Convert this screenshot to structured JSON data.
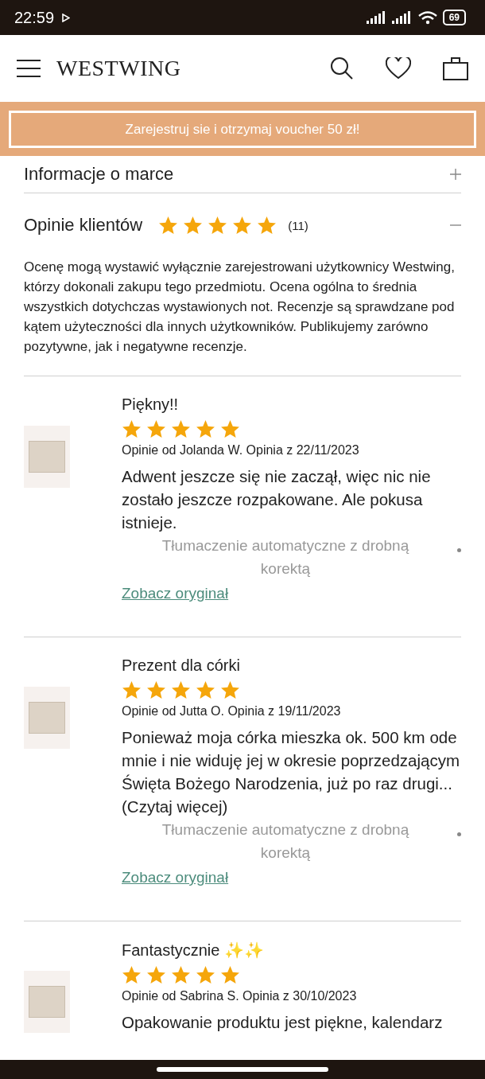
{
  "status_bar": {
    "time": "22:59",
    "battery": "69"
  },
  "header": {
    "logo": "WESTWING"
  },
  "banner": {
    "text": "Zarejestruj sie i otrzymaj voucher 50 zł!"
  },
  "sections": [
    {
      "title": "Informacje o marce",
      "expanded": false
    }
  ],
  "reviews_section": {
    "title": "Opinie klientów",
    "stars": 5,
    "count": "(11)",
    "expanded": true,
    "description": "Ocenę mogą wystawić wyłącznie zarejestrowani użytkownicy Westwing, którzy dokonali zakupu tego przedmiotu. Ocena ogólna to średnia wszystkich dotychczas wystawionych not. Recenzje są sprawdzane pod kątem użyteczności dla innych użytkowników. Publikujemy zarówno pozytywne, jak i negatywne recenzje."
  },
  "reviews": [
    {
      "title": "Piękny!!",
      "stars": 5,
      "meta": "Opinie od Jolanda W. Opinia z 22/11/2023",
      "body": "Adwent jeszcze się nie zaczął, więc nic nie zostało jeszcze rozpakowane. Ale pokusa istnieje.",
      "translation_note": "Tłumaczenie automatyczne z drobną korektą",
      "link": "Zobacz oryginał"
    },
    {
      "title": "Prezent dla córki",
      "stars": 5,
      "meta": "Opinie od Jutta O. Opinia z 19/11/2023",
      "body": "Ponieważ moja córka mieszka ok. 500 km ode mnie i nie widuję jej w okresie poprzedzającym Święta Bożego Narodzenia, już po raz drugi...",
      "read_more": "(Czytaj więcej)",
      "translation_note": "Tłumaczenie automatyczne z drobną korektą",
      "link": "Zobacz oryginał"
    },
    {
      "title": "Fantastycznie ✨✨",
      "stars": 5,
      "meta": "Opinie od Sabrina S. Opinia z 30/10/2023",
      "body": "Opakowanie produktu jest piękne, kalendarz"
    }
  ]
}
